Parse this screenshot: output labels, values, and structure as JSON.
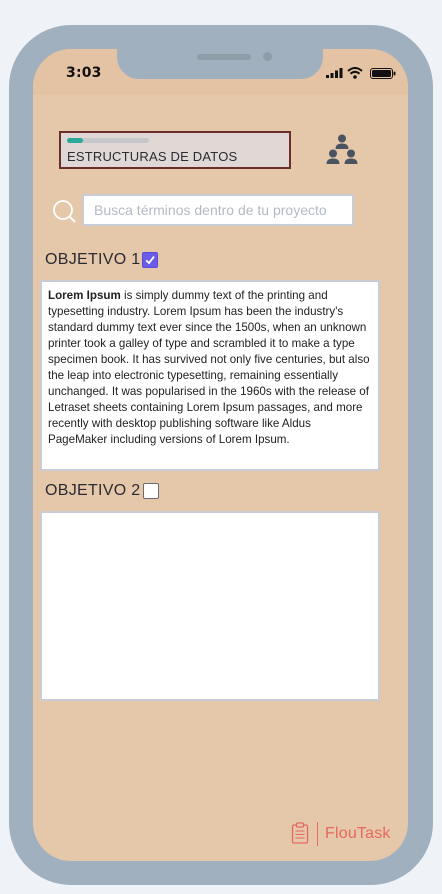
{
  "status_bar": {
    "time": "3:03"
  },
  "project": {
    "title": "ESTRUCTURAS DE DATOS",
    "progress": 0.2
  },
  "search": {
    "placeholder": "Busca términos dentro de tu proyecto",
    "value": ""
  },
  "objectives": [
    {
      "label": "OBJETIVO 1",
      "checked": true,
      "text_bold": "Lorem Ipsum",
      "text": " is simply dummy text of the printing and typesetting industry. Lorem Ipsum has been the industry's standard dummy text ever since the 1500s, when an unknown printer took a galley of type and scrambled it to make a type specimen book. It has survived not only five centuries, but also the leap into electronic typesetting, remaining essentially unchanged. It was popularised in the 1960s with the release of Letraset sheets containing Lorem Ipsum passages, and more recently with desktop publishing software like Aldus PageMaker including versions of Lorem Ipsum."
    },
    {
      "label": "OBJETIVO 2",
      "checked": false,
      "text": ""
    }
  ],
  "brand": {
    "name": "FlouTask"
  },
  "icons": {
    "team": "team-hierarchy-icon",
    "search": "search-icon",
    "brand": "clipboard-icon",
    "signal": "signal-icon",
    "wifi": "wifi-icon",
    "battery": "battery-icon"
  },
  "colors": {
    "background": "#e5c7a9",
    "frame": "#a0b0be",
    "progress": "#2aa899",
    "checkbox_checked": "#6a5ce6",
    "brand": "#e8685e",
    "project_border": "#6a2f2a"
  }
}
